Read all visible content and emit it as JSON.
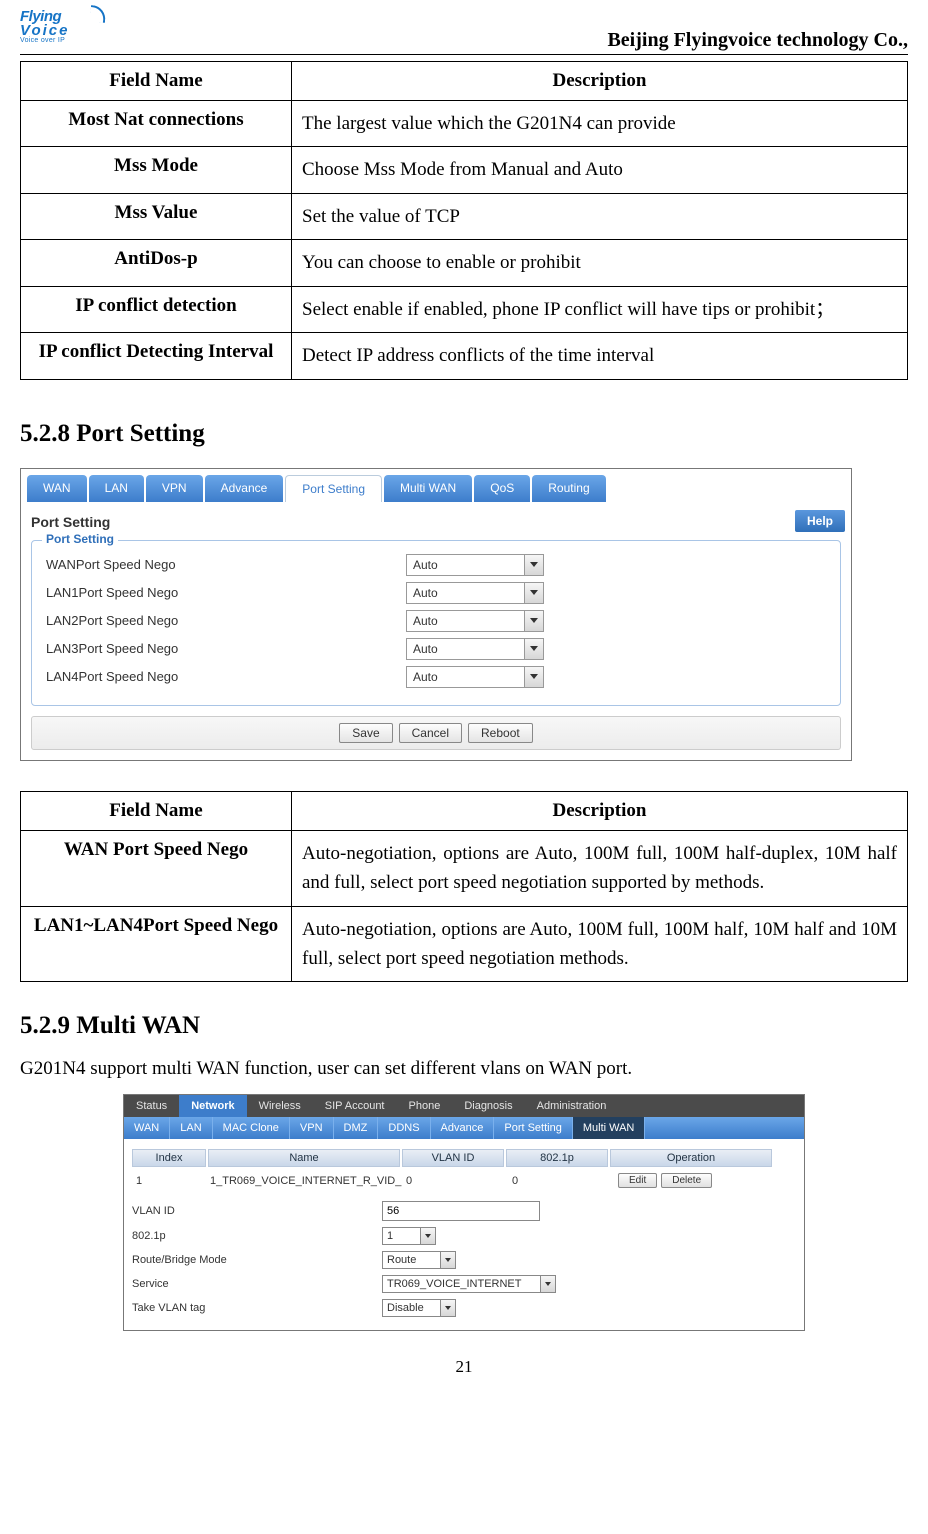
{
  "header": {
    "logo_line1": "Flying",
    "logo_line2": "Voice",
    "logo_tag": "Voice over IP",
    "company": "Beijing Flyingvoice technology Co.,"
  },
  "table1": {
    "head_field": "Field Name",
    "head_desc": "Description",
    "rows": [
      {
        "field": "Most Nat connections",
        "desc": "The largest value which the G201N4 can provide"
      },
      {
        "field": "Mss Mode",
        "desc": "Choose Mss Mode from Manual and Auto"
      },
      {
        "field": "Mss Value",
        "desc": "Set the value of TCP"
      },
      {
        "field": "AntiDos-p",
        "desc": "You can choose to enable or prohibit"
      },
      {
        "field": "IP conflict detection",
        "desc": "Select enable if enabled, phone IP conflict will have tips or prohibit；"
      },
      {
        "field": "IP conflict Detecting Interval",
        "desc": "Detect IP address conflicts of the time interval"
      }
    ]
  },
  "section_port": "5.2.8 Port Setting",
  "port_shot": {
    "tabs": [
      "WAN",
      "LAN",
      "VPN",
      "Advance",
      "Port Setting",
      "Multi WAN",
      "QoS",
      "Routing"
    ],
    "active_tab_index": 4,
    "panel_title": "Port Setting",
    "help": "Help",
    "legend": "Port Setting",
    "rows": [
      {
        "label": "WANPort Speed Nego",
        "value": "Auto"
      },
      {
        "label": "LAN1Port Speed Nego",
        "value": "Auto"
      },
      {
        "label": "LAN2Port Speed Nego",
        "value": "Auto"
      },
      {
        "label": "LAN3Port Speed Nego",
        "value": "Auto"
      },
      {
        "label": "LAN4Port Speed Nego",
        "value": "Auto"
      }
    ],
    "buttons": {
      "save": "Save",
      "cancel": "Cancel",
      "reboot": "Reboot"
    }
  },
  "table2": {
    "head_field": "Field Name",
    "head_desc": "Description",
    "rows": [
      {
        "field": "WAN Port Speed Nego",
        "desc": "Auto-negotiation, options are Auto, 100M full, 100M half-duplex, 10M half and full, select port speed negotiation supported by methods."
      },
      {
        "field": "LAN1~LAN4Port Speed Nego",
        "desc": "Auto-negotiation, options are Auto, 100M full, 100M half, 10M half and 10M full, select port speed negotiation methods."
      }
    ]
  },
  "section_multi": "5.2.9 Multi WAN",
  "multi_intro": "G201N4 support multi WAN function, user can set different vlans on WAN port.",
  "mw_shot": {
    "toptabs": [
      "Status",
      "Network",
      "Wireless",
      "SIP Account",
      "Phone",
      "Diagnosis",
      "Administration"
    ],
    "toptab_active_index": 1,
    "subtabs": [
      "WAN",
      "LAN",
      "MAC Clone",
      "VPN",
      "DMZ",
      "DDNS",
      "Advance",
      "Port Setting",
      "Multi WAN"
    ],
    "subtab_active_index": 8,
    "cols": {
      "index": "Index",
      "name": "Name",
      "vlan": "VLAN ID",
      "pbit": "802.1p",
      "op": "Operation"
    },
    "row1": {
      "index": "1",
      "name": "1_TR069_VOICE_INTERNET_R_VID_",
      "vlan": "0",
      "pbit": "0"
    },
    "buttons": {
      "edit": "Edit",
      "delete": "Delete"
    },
    "form": {
      "vlan_label": "VLAN ID",
      "vlan_value": "56",
      "pbit_label": "802.1p",
      "pbit_value": "1",
      "mode_label": "Route/Bridge Mode",
      "mode_value": "Route",
      "service_label": "Service",
      "service_value": "TR069_VOICE_INTERNET",
      "take_label": "Take VLAN tag",
      "take_value": "Disable"
    }
  },
  "page_number": "21"
}
